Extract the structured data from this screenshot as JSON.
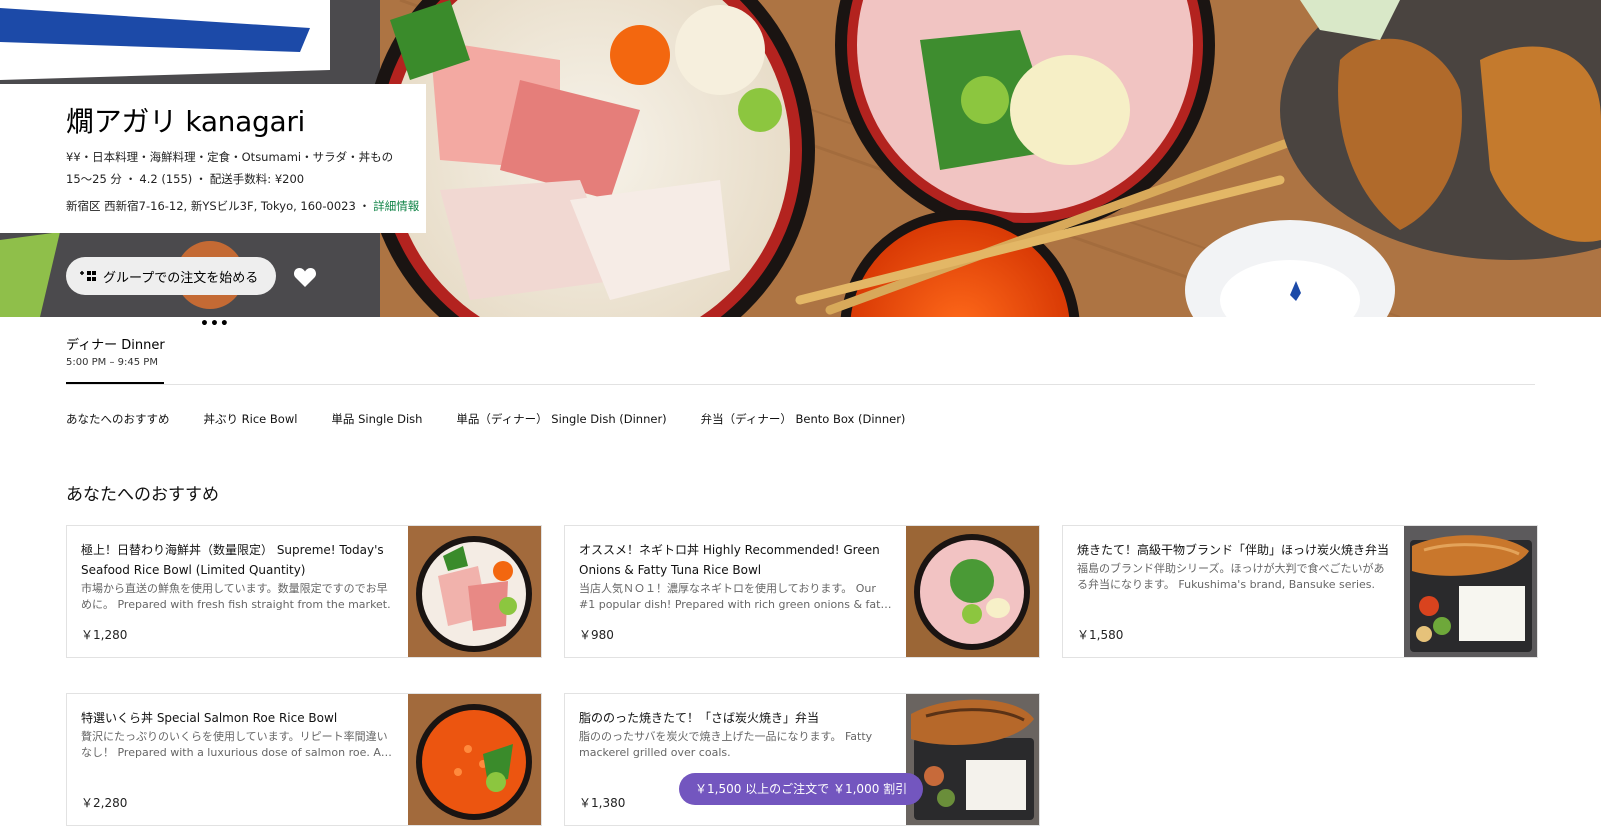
{
  "store": {
    "name": "燗アガリ kanagari",
    "price_and_categories": "¥¥・日本料理・海鮮料理・定食・Otsumami・サラダ・丼もの",
    "eta": "15～25 分",
    "rating": "4.2 (155)",
    "delivery_fee": "配送手数料: ¥200",
    "address": "新宿区 西新宿7-16-12, 新YSビル3F, Tokyo, 160-0023",
    "details_link": "詳細情報"
  },
  "actions": {
    "group_order_label": "グループでの注文を始める",
    "more_label": "•••"
  },
  "menu_tab": {
    "title": "ディナー Dinner",
    "hours": "5:00 PM – 9:45 PM"
  },
  "categories": [
    "あなたへのおすすめ",
    "丼ぶり Rice Bowl",
    "単品 Single Dish",
    "単品（ディナー） Single Dish (Dinner)",
    "弁当（ディナー） Bento Box (Dinner)"
  ],
  "section_title": "あなたへのおすすめ",
  "items": [
    {
      "title": "極上！日替わり海鮮丼（数量限定） Supreme! Today's Seafood Rice Bowl (Limited Quantity)",
      "description": "市場から直送の鮮魚を使用しています。数量限定ですのでお早めに。 Prepared with fresh fish straight from the market.",
      "price": "￥1,280",
      "image": "kaisendon-photo"
    },
    {
      "title": "オススメ！ネギトロ丼 Highly Recommended! Green Onions & Fatty Tuna Rice Bowl",
      "description": "当店人気ＮＯ１！濃厚なネギトロを使用しております。 Our #1 popular dish! Prepared with rich green onions & fatty tuna.",
      "price": "￥980",
      "image": "negitoro-photo"
    },
    {
      "title": "焼きたて！高級干物ブランド「伴助」ほっけ炭火焼き弁当",
      "description": "福島のブランド伴助シリーズ。ほっけが大判で食べごたいがある弁当になります。 Fukushima's brand, Bansuke series.",
      "price": "￥1,580",
      "image": "hokke-bento-photo"
    },
    {
      "title": "特選いくら丼 Special Salmon Roe Rice Bowl",
      "description": "贅沢にたっぷりのいくらを使用しています。リピート率間違いなし！ Prepared with a luxurious dose of salmon roe. A must-try.",
      "price": "￥2,280",
      "image": "ikura-don-photo"
    },
    {
      "title": "脂ののった焼きたて！「さば炭火焼き」弁当",
      "description": "脂ののったサバを炭火で焼き上げた一品になります。 Fatty mackerel grilled over coals.",
      "price": "￥1,380",
      "image": "saba-bento-photo"
    }
  ],
  "promo": {
    "label": "￥1,500 以上のご注文で ￥1,000 割引"
  },
  "colors": {
    "link_green": "#0e8345",
    "promo_purple": "#7356bf"
  }
}
